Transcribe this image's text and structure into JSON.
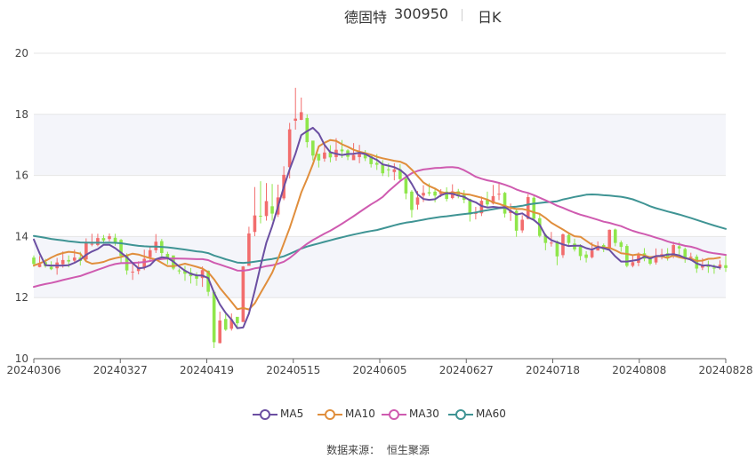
{
  "header": {
    "stock_name": "德固特",
    "stock_code": "300950",
    "period": "日K"
  },
  "legend": {
    "items": [
      {
        "label": "MA5",
        "color": "#6b4fa2"
      },
      {
        "label": "MA10",
        "color": "#e08e3c"
      },
      {
        "label": "MA30",
        "color": "#cf5bb0"
      },
      {
        "label": "MA60",
        "color": "#3f9494"
      }
    ]
  },
  "source": {
    "label": "数据来源：",
    "name": "恒生聚源"
  },
  "colors": {
    "up": "#f26d6d",
    "down": "#8fe64b",
    "band": "#f4f5fa",
    "grid": "#e6e6e6"
  },
  "chart_data": {
    "type": "candlestick",
    "y_ticks": [
      "10",
      "12",
      "14",
      "16",
      "18",
      "20"
    ],
    "ylim": [
      10,
      20
    ],
    "x_tick_labels": [
      "20240306",
      "20240327",
      "20240419",
      "20240515",
      "20240605",
      "20240627",
      "20240718",
      "20240808",
      "20240828"
    ],
    "n_days": 120,
    "candles_ohlc": [
      [
        13.31,
        13.1,
        13.38,
        13.01
      ],
      [
        13.0,
        13.1,
        13.36,
        12.99
      ],
      [
        13.16,
        13.03,
        13.27,
        12.98
      ],
      [
        13.01,
        12.93,
        13.19,
        12.9
      ],
      [
        12.96,
        13.15,
        13.3,
        12.75
      ],
      [
        13.09,
        13.23,
        13.51,
        12.98
      ],
      [
        13.23,
        13.18,
        13.38,
        12.99
      ],
      [
        13.21,
        13.31,
        13.57,
        13.14
      ],
      [
        13.31,
        13.2,
        13.5,
        13.05
      ],
      [
        13.25,
        13.8,
        13.94,
        13.18
      ],
      [
        13.74,
        13.76,
        14.09,
        13.68
      ],
      [
        13.72,
        13.95,
        14.09,
        13.68
      ],
      [
        13.95,
        13.87,
        14.05,
        13.77
      ],
      [
        13.92,
        14.01,
        14.1,
        13.84
      ],
      [
        13.96,
        13.8,
        14.09,
        13.7
      ],
      [
        13.89,
        13.37,
        13.92,
        13.13
      ],
      [
        13.38,
        12.89,
        13.45,
        12.75
      ],
      [
        12.83,
        12.85,
        13.1,
        12.58
      ],
      [
        12.87,
        13.0,
        13.19,
        12.76
      ],
      [
        12.99,
        13.27,
        13.57,
        12.9
      ],
      [
        13.32,
        13.55,
        13.67,
        13.21
      ],
      [
        13.55,
        13.83,
        14.08,
        13.46
      ],
      [
        13.85,
        13.46,
        13.92,
        13.35
      ],
      [
        13.43,
        13.3,
        13.5,
        13.09
      ],
      [
        13.38,
        12.95,
        13.38,
        12.9
      ],
      [
        12.89,
        12.86,
        12.95,
        12.77
      ],
      [
        12.89,
        12.78,
        13.04,
        12.55
      ],
      [
        12.82,
        12.7,
        12.97,
        12.46
      ],
      [
        12.73,
        12.62,
        12.83,
        12.39
      ],
      [
        12.64,
        12.9,
        13.02,
        12.35
      ],
      [
        12.88,
        12.19,
        12.89,
        12.05
      ],
      [
        12.19,
        10.54,
        12.24,
        10.35
      ],
      [
        10.51,
        11.25,
        11.54,
        10.5
      ],
      [
        11.3,
        10.95,
        11.47,
        10.91
      ],
      [
        10.98,
        11.29,
        11.48,
        10.92
      ],
      [
        11.37,
        11.16,
        11.3,
        10.97
      ],
      [
        11.2,
        13.02,
        13.03,
        11.25
      ],
      [
        13.04,
        14.1,
        14.32,
        13.11
      ],
      [
        14.15,
        14.69,
        15.62,
        14.01
      ],
      [
        14.68,
        14.67,
        15.81,
        14.43
      ],
      [
        14.67,
        15.16,
        15.75,
        14.52
      ],
      [
        14.99,
        14.75,
        15.72,
        14.52
      ],
      [
        14.72,
        15.28,
        15.7,
        14.64
      ],
      [
        15.25,
        16.02,
        16.3,
        15.19
      ],
      [
        16.27,
        17.51,
        17.72,
        15.9
      ],
      [
        17.79,
        17.86,
        18.87,
        17.5
      ],
      [
        17.82,
        18.07,
        18.55,
        17.81
      ],
      [
        17.88,
        17.09,
        18.0,
        16.91
      ],
      [
        17.14,
        16.65,
        17.13,
        16.49
      ],
      [
        16.71,
        16.49,
        16.64,
        16.26
      ],
      [
        16.55,
        16.75,
        16.99,
        16.45
      ],
      [
        16.76,
        16.59,
        16.99,
        16.43
      ],
      [
        16.6,
        16.84,
        17.22,
        16.48
      ],
      [
        16.85,
        16.79,
        17.16,
        16.57
      ],
      [
        16.82,
        16.61,
        16.86,
        16.5
      ],
      [
        16.5,
        16.67,
        17.06,
        16.53
      ],
      [
        16.6,
        16.72,
        17.0,
        16.4
      ],
      [
        16.7,
        16.56,
        16.83,
        16.47
      ],
      [
        16.63,
        16.37,
        16.65,
        16.26
      ],
      [
        16.41,
        16.35,
        16.7,
        16.18
      ],
      [
        16.35,
        16.07,
        16.5,
        15.98
      ],
      [
        16.2,
        16.18,
        16.4,
        15.95
      ],
      [
        16.11,
        16.2,
        16.4,
        15.84
      ],
      [
        16.2,
        15.88,
        16.37,
        15.79
      ],
      [
        15.91,
        15.41,
        15.88,
        15.22
      ],
      [
        15.47,
        14.87,
        15.52,
        14.62
      ],
      [
        15.04,
        15.28,
        15.49,
        14.88
      ],
      [
        15.34,
        15.43,
        15.68,
        15.13
      ],
      [
        15.45,
        15.41,
        15.74,
        15.33
      ],
      [
        15.47,
        15.34,
        15.6,
        15.12
      ],
      [
        15.39,
        15.46,
        15.55,
        15.29
      ],
      [
        15.47,
        15.23,
        15.61,
        15.15
      ],
      [
        15.26,
        15.48,
        15.71,
        15.22
      ],
      [
        15.48,
        15.32,
        15.56,
        15.25
      ],
      [
        15.38,
        15.2,
        15.52,
        15.09
      ],
      [
        15.23,
        14.72,
        15.24,
        14.49
      ],
      [
        14.75,
        14.77,
        14.97,
        14.56
      ],
      [
        14.76,
        15.17,
        15.31,
        14.67
      ],
      [
        15.2,
        15.05,
        15.47,
        14.94
      ],
      [
        15.08,
        15.32,
        15.69,
        15.05
      ],
      [
        15.38,
        15.4,
        15.76,
        15.19
      ],
      [
        15.43,
        14.75,
        15.46,
        14.62
      ],
      [
        14.77,
        14.85,
        15.08,
        14.51
      ],
      [
        14.84,
        14.19,
        14.87,
        13.99
      ],
      [
        14.2,
        14.55,
        14.7,
        14.12
      ],
      [
        14.58,
        15.29,
        15.39,
        14.56
      ],
      [
        15.27,
        14.58,
        15.35,
        14.5
      ],
      [
        14.6,
        14.02,
        14.74,
        13.97
      ],
      [
        14.06,
        13.79,
        14.1,
        13.55
      ],
      [
        13.77,
        13.8,
        14.15,
        13.67
      ],
      [
        13.84,
        13.35,
        13.87,
        13.06
      ],
      [
        13.39,
        14.07,
        14.1,
        13.3
      ],
      [
        14.05,
        13.79,
        14.11,
        13.72
      ],
      [
        13.77,
        13.58,
        13.93,
        13.51
      ],
      [
        13.67,
        13.36,
        13.75,
        13.22
      ],
      [
        13.41,
        13.3,
        13.52,
        13.15
      ],
      [
        13.32,
        13.54,
        13.81,
        13.28
      ],
      [
        13.54,
        13.7,
        13.84,
        13.56
      ],
      [
        13.72,
        13.58,
        13.77,
        13.49
      ],
      [
        13.59,
        14.22,
        14.23,
        13.57
      ],
      [
        14.23,
        13.79,
        14.26,
        13.68
      ],
      [
        13.81,
        13.66,
        13.87,
        13.5
      ],
      [
        13.69,
        13.04,
        13.75,
        12.99
      ],
      [
        13.04,
        13.16,
        13.41,
        12.99
      ],
      [
        13.14,
        13.41,
        13.48,
        13.03
      ],
      [
        13.45,
        13.27,
        13.62,
        13.19
      ],
      [
        13.3,
        13.11,
        13.36,
        13.06
      ],
      [
        13.15,
        13.33,
        13.61,
        13.08
      ],
      [
        13.35,
        13.42,
        13.6,
        13.25
      ],
      [
        13.45,
        13.32,
        13.62,
        13.21
      ],
      [
        13.36,
        13.72,
        13.83,
        13.29
      ],
      [
        13.68,
        13.61,
        13.82,
        13.36
      ],
      [
        13.59,
        13.28,
        13.64,
        13.14
      ],
      [
        13.31,
        13.34,
        13.47,
        13.2
      ],
      [
        13.34,
        12.95,
        13.41,
        12.81
      ],
      [
        12.98,
        13.05,
        13.29,
        12.9
      ],
      [
        13.05,
        13.0,
        13.21,
        12.81
      ],
      [
        12.98,
        12.95,
        13.09,
        12.78
      ],
      [
        12.98,
        13.08,
        13.22,
        12.91
      ],
      [
        13.06,
        12.97,
        13.42,
        12.84
      ]
    ],
    "moving_averages": {
      "MA5": [
        13.9,
        13.45,
        13.06,
        13.05,
        13.05,
        13.05,
        13.06,
        13.14,
        13.24,
        13.4,
        13.51,
        13.59,
        13.73,
        13.73,
        13.62,
        13.47,
        13.32,
        13.13,
        12.96,
        12.98,
        13.06,
        13.26,
        13.32,
        13.3,
        13.18,
        13.02,
        12.88,
        12.78,
        12.73,
        12.72,
        12.64,
        12.16,
        11.78,
        11.5,
        11.28,
        11.0,
        11.02,
        11.48,
        12.22,
        13.04,
        13.8,
        14.35,
        14.98,
        15.62,
        16.2,
        16.71,
        17.32,
        17.45,
        17.56,
        17.37,
        17.0,
        16.76,
        16.71,
        16.67,
        16.7,
        16.71,
        16.74,
        16.7,
        16.6,
        16.51,
        16.36,
        16.32,
        16.27,
        16.18,
        16.02,
        15.72,
        15.38,
        15.23,
        15.2,
        15.22,
        15.35,
        15.42,
        15.4,
        15.34,
        15.3,
        15.19,
        15.12,
        15.0,
        14.95,
        14.97,
        14.95,
        14.96,
        14.84,
        14.72,
        14.76,
        14.63,
        14.54,
        14.38,
        14.03,
        13.88,
        13.81,
        13.74,
        13.69,
        13.7,
        13.7,
        13.62,
        13.57,
        13.66,
        13.62,
        13.56,
        13.35,
        13.18,
        13.18,
        13.21,
        13.24,
        13.34,
        13.28,
        13.36,
        13.37,
        13.41,
        13.42,
        13.38,
        13.3,
        13.24,
        13.12,
        13.05,
        13.06,
        13.02,
        12.98
      ],
      "MA10": [
        13.05,
        13.12,
        13.2,
        13.31,
        13.4,
        13.46,
        13.5,
        13.48,
        13.44,
        13.19,
        13.11,
        13.13,
        13.17,
        13.24,
        13.29,
        13.33,
        13.38,
        13.44,
        13.41,
        13.35,
        13.29,
        13.25,
        13.14,
        13.03,
        13.03,
        13.06,
        13.11,
        13.06,
        13.01,
        12.95,
        12.83,
        12.6,
        12.32,
        12.09,
        11.86,
        11.62,
        11.66,
        11.61,
        11.81,
        12.15,
        12.48,
        12.82,
        13.27,
        13.77,
        14.28,
        14.85,
        15.44,
        15.89,
        16.37,
        16.95,
        17.07,
        17.16,
        17.13,
        17.02,
        16.94,
        16.84,
        16.78,
        16.73,
        16.68,
        16.61,
        16.56,
        16.52,
        16.48,
        16.45,
        16.37,
        16.19,
        15.98,
        15.77,
        15.65,
        15.57,
        15.46,
        15.42,
        15.44,
        15.43,
        15.39,
        15.37,
        15.32,
        15.27,
        15.21,
        15.12,
        15.07,
        15.0,
        14.94,
        14.9,
        14.9,
        14.86,
        14.79,
        14.74,
        14.61,
        14.45,
        14.34,
        14.23,
        14.11,
        14.01,
        13.99,
        13.86,
        13.73,
        13.66,
        13.64,
        13.63,
        13.55,
        13.45,
        13.43,
        13.39,
        13.42,
        13.38,
        13.32,
        13.35,
        13.35,
        13.3,
        13.38,
        13.32,
        13.28,
        13.28,
        13.2,
        13.21,
        13.27,
        13.28,
        13.31
      ]
    }
  }
}
